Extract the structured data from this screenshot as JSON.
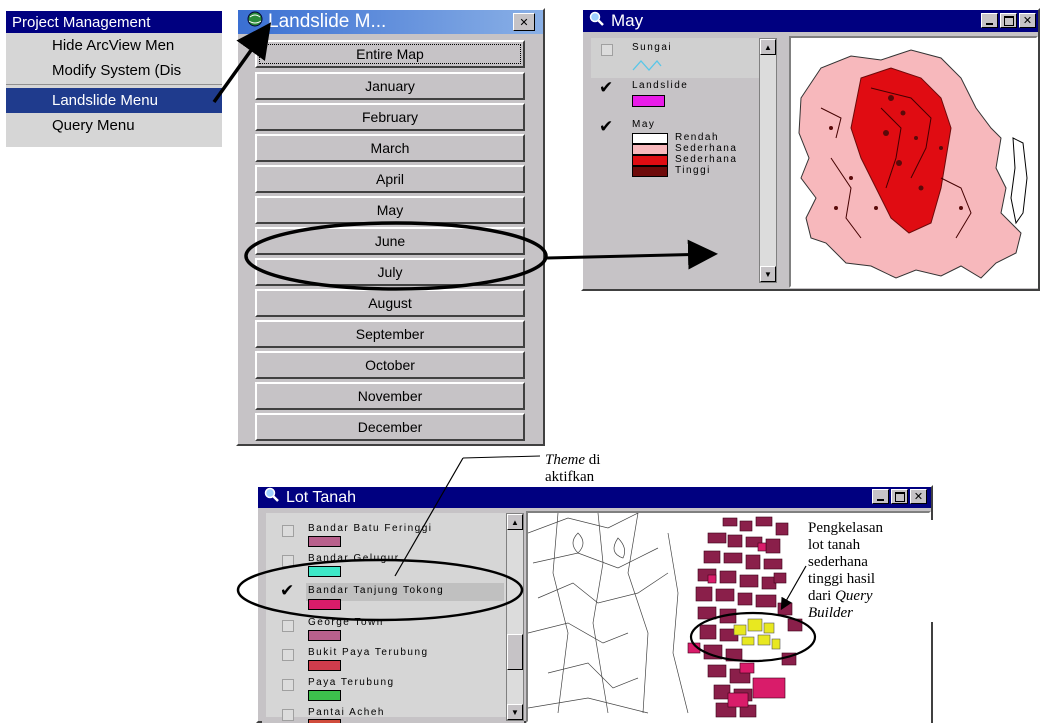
{
  "project_menu": {
    "title": "Project Management",
    "items": [
      {
        "label": "Hide ArcView Men"
      },
      {
        "label": "Modify System (Dis"
      },
      {
        "label": "Landslide Menu",
        "selected": true
      },
      {
        "label": "Query Menu"
      }
    ]
  },
  "landslide_window": {
    "title": "Landslide M...",
    "close_glyph": "✕",
    "buttons": [
      "Entire Map",
      "January",
      "February",
      "March",
      "April",
      "May",
      "June",
      "July",
      "August",
      "September",
      "October",
      "November",
      "December"
    ]
  },
  "may_window": {
    "title": "May",
    "legend": {
      "sungai": {
        "label": "Sungai",
        "checked": false
      },
      "landslide": {
        "label": "Landslide",
        "checked": true,
        "color": "#e81ce8"
      },
      "may": {
        "label": "May",
        "checked": true,
        "classes": [
          {
            "label": "Rendah",
            "color": "#ffffff"
          },
          {
            "label": "Sederhana",
            "color": "#f7b8bc"
          },
          {
            "label": "Sederhana",
            "color": "#e00c12"
          },
          {
            "label": "Tinggi",
            "color": "#6e0a0a"
          }
        ]
      }
    }
  },
  "lot_window": {
    "title": "Lot Tanah",
    "legend": [
      {
        "label": "Bandar Batu Feringgi",
        "checked": false,
        "color": "#b8608c"
      },
      {
        "label": "Bandar Gelugur",
        "checked": false,
        "color": "#3ee8c8"
      },
      {
        "label": "Bandar Tanjung Tokong",
        "checked": true,
        "color": "#d91c6a"
      },
      {
        "label": "George Town",
        "checked": false,
        "color": "#b8608c"
      },
      {
        "label": "Bukit Paya Terubung",
        "checked": false,
        "color": "#d03c4c"
      },
      {
        "label": "Paya Terubung",
        "checked": false,
        "color": "#3cc04c"
      },
      {
        "label": "Pantai Acheh",
        "checked": false,
        "color": "#d04c3c"
      }
    ]
  },
  "annotations": {
    "theme_italic": "Theme",
    "theme_rest": " di",
    "theme_line2": "aktifkan",
    "pk_line1": "Pengkelasan",
    "pk_line2": "lot tanah",
    "pk_line3": "sederhana",
    "pk_line4": "tinggi hasil",
    "pk_line5_a": "dari ",
    "pk_line5_b": "Query",
    "pk_line6": "Builder"
  }
}
